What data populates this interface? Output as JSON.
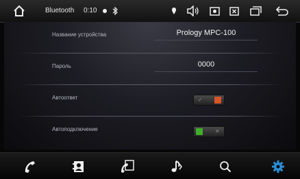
{
  "status_bar": {
    "title": "Bluetooth",
    "time": "0:10"
  },
  "settings": [
    {
      "label": "Название устройства",
      "value": "Prology MPC-100"
    },
    {
      "label": "Пароль",
      "value": "0000"
    },
    {
      "label": "Автоответ",
      "state": "off"
    },
    {
      "label": "Автоподключение",
      "state": "on"
    }
  ],
  "icons": {
    "home": "home-icon",
    "settings_dot": "dot-icon",
    "bluetooth": "bluetooth-icon",
    "location": "location-icon",
    "volume": "volume-icon",
    "picture": "picture-icon",
    "close_box": "close-box-icon",
    "window": "window-icon",
    "back": "back-icon",
    "phone": "phone-icon",
    "contacts": "contacts-icon",
    "call_log": "call-log-icon",
    "music": "music-icon",
    "search": "search-icon",
    "gear": "gear-icon"
  },
  "colors": {
    "accent": "#2a8fd8",
    "toggle_on": "#3fae2a",
    "toggle_off": "#d8552a"
  }
}
